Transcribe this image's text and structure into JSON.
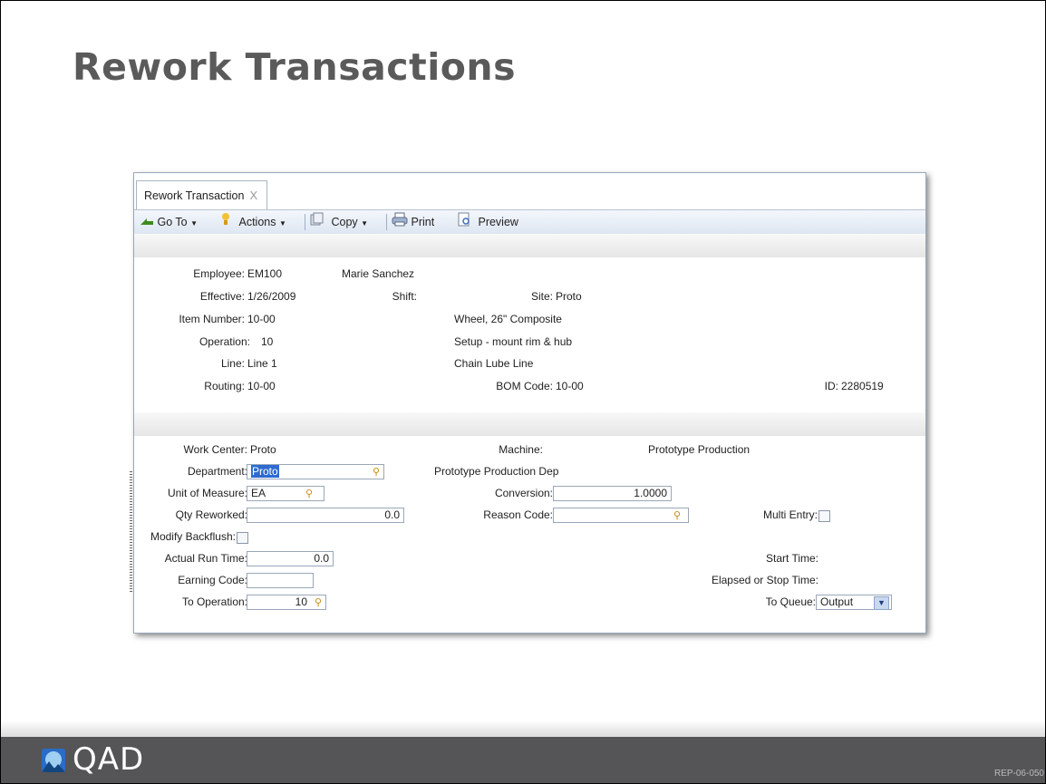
{
  "slide": {
    "title": "Rework Transactions",
    "footer_code": "REP-06-050",
    "brand": "QAD"
  },
  "tab": {
    "label": "Rework Transaction",
    "close": "X"
  },
  "toolbar": {
    "goto": "Go To",
    "actions": "Actions",
    "copy": "Copy",
    "print": "Print",
    "preview": "Preview"
  },
  "header": {
    "employee_label": "Employee:",
    "employee": "EM100",
    "employee_name": "Marie Sanchez",
    "effective_label": "Effective:",
    "effective": "1/26/2009",
    "shift_label": "Shift:",
    "site_label": "Site:",
    "site": "Proto",
    "item_label": "Item Number:",
    "item": "10-00",
    "item_desc": "Wheel, 26\" Composite",
    "operation_label": "Operation:",
    "operation": "10",
    "operation_desc": "Setup - mount rim & hub",
    "line_label": "Line:",
    "line": "Line 1",
    "line_desc": "Chain Lube Line",
    "routing_label": "Routing:",
    "routing": "10-00",
    "bom_label": "BOM Code:",
    "bom": "10-00",
    "id_label": "ID:",
    "id": "2280519"
  },
  "detail": {
    "work_center_label": "Work Center:",
    "work_center": "Proto",
    "machine_label": "Machine:",
    "machine_desc": "Prototype Production",
    "department_label": "Department:",
    "department": "Proto",
    "department_desc": "Prototype Production Dep",
    "uom_label": "Unit of Measure:",
    "uom": "EA",
    "conversion_label": "Conversion:",
    "conversion": "1.0000",
    "qty_label": "Qty Reworked:",
    "qty": "0.0",
    "reason_label": "Reason Code:",
    "reason": "",
    "multi_entry_label": "Multi Entry:",
    "modify_backflush_label": "Modify Backflush:",
    "run_time_label": "Actual Run Time:",
    "run_time": "0.0",
    "start_time_label": "Start Time:",
    "earning_label": "Earning Code:",
    "earning": "",
    "elapsed_label": "Elapsed or Stop Time:",
    "to_op_label": "To Operation:",
    "to_op": "10",
    "to_queue_label": "To Queue:",
    "to_queue": "Output"
  }
}
